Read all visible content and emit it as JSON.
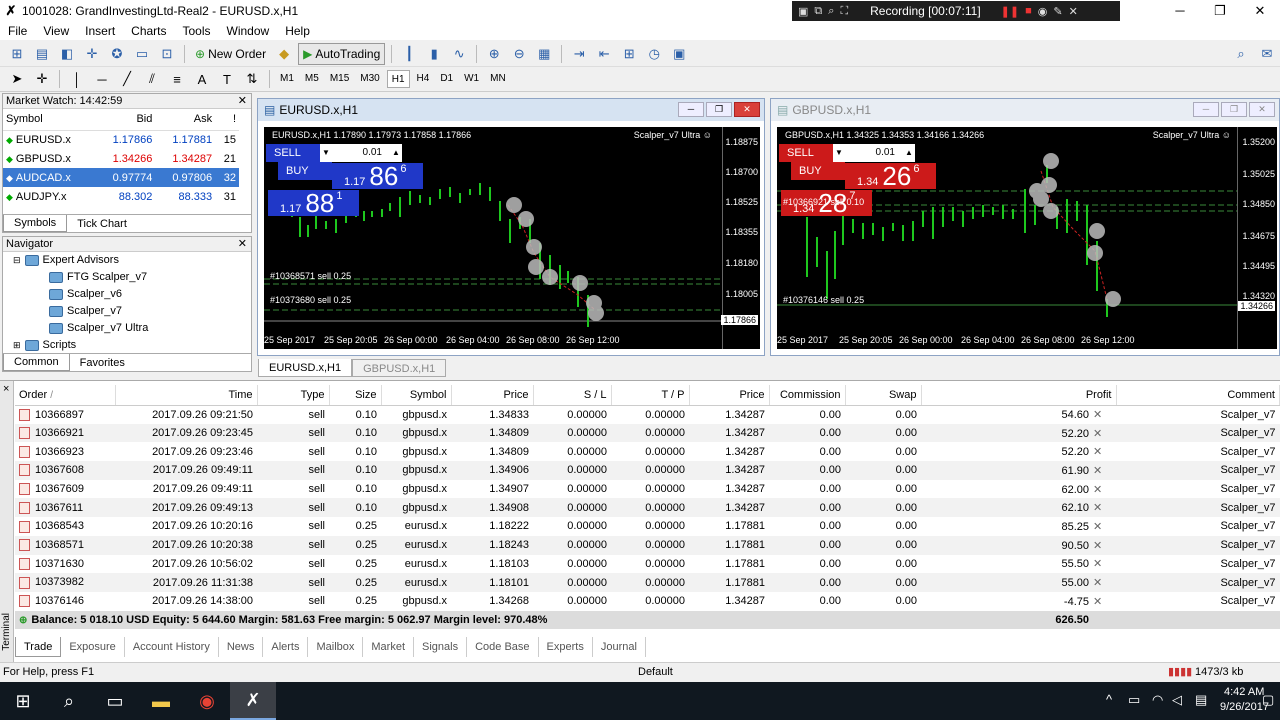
{
  "window": {
    "title": "1001028: GrandInvestingLtd-Real2 - EURUSD.x,H1",
    "logo": "✗"
  },
  "recorder": {
    "status": "Recording [00:07:11]"
  },
  "menu": [
    "File",
    "View",
    "Insert",
    "Charts",
    "Tools",
    "Window",
    "Help"
  ],
  "toolbar": {
    "new_order": "New Order",
    "autotrading": "AutoTrading"
  },
  "timeframes": [
    "M1",
    "M5",
    "M15",
    "M30",
    "H1",
    "H4",
    "D1",
    "W1",
    "MN"
  ],
  "market_watch": {
    "title": "Market Watch: 14:42:59",
    "headers": [
      "Symbol",
      "Bid",
      "Ask",
      "!"
    ],
    "rows": [
      {
        "symbol": "EURUSD.x",
        "bid": "1.17866",
        "ask": "1.17881",
        "spread": "15",
        "dir": "up"
      },
      {
        "symbol": "GBPUSD.x",
        "bid": "1.34266",
        "ask": "1.34287",
        "spread": "21",
        "dir": "up"
      },
      {
        "symbol": "AUDCAD.x",
        "bid": "0.97774",
        "ask": "0.97806",
        "spread": "32",
        "dir": "dn"
      },
      {
        "symbol": "AUDJPY.x",
        "bid": "88.302",
        "ask": "88.333",
        "spread": "31",
        "dir": "up"
      }
    ],
    "tabs": [
      "Symbols",
      "Tick Chart"
    ]
  },
  "navigator": {
    "title": "Navigator",
    "expert_advisors": "Expert Advisors",
    "items": [
      "FTG Scalper_v7",
      "Scalper_v6",
      "Scalper_v7",
      "Scalper_v7 Ultra"
    ],
    "scripts": "Scripts",
    "tabs": [
      "Common",
      "Favorites"
    ]
  },
  "chart_eur": {
    "window_title": "EURUSD.x,H1",
    "info": "EURUSD.x,H1  1.17890 1.17973 1.17858 1.17866",
    "ea": "Scalper_v7 Ultra ☺",
    "sell": "SELL",
    "buy": "BUY",
    "lot": "0.01",
    "sell_small": "1.17",
    "sell_big": "86",
    "sell_sup": "6",
    "buy_small": "1.17",
    "buy_big": "88",
    "buy_sup": "1",
    "yticks": [
      "1.18875",
      "1.18700",
      "1.18525",
      "1.18355",
      "1.18180",
      "1.18005",
      "1.17866"
    ],
    "xticks": [
      "25 Sep 2017",
      "25 Sep 20:05",
      "26 Sep 00:00",
      "26 Sep 04:00",
      "26 Sep 08:00",
      "26 Sep 12:00"
    ],
    "labels": [
      "#10368571 sell 0.25",
      "#10373680 sell 0.25"
    ]
  },
  "chart_gbp": {
    "window_title": "GBPUSD.x,H1",
    "info": "GBPUSD.x,H1  1.34325 1.34353 1.34166 1.34266",
    "ea": "Scalper_v7 Ultra ☺",
    "sell": "SELL",
    "buy": "BUY",
    "lot": "0.01",
    "sell_small": "1.34",
    "sell_big": "26",
    "sell_sup": "6",
    "buy_small": "1.34",
    "buy_big": "28",
    "buy_sup": "7",
    "yticks": [
      "1.35200",
      "1.35025",
      "1.34850",
      "1.34675",
      "1.34495",
      "1.34320",
      "1.34266"
    ],
    "xticks": [
      "25 Sep 2017",
      "25 Sep 20:05",
      "26 Sep 00:00",
      "26 Sep 04:00",
      "26 Sep 08:00",
      "26 Sep 12:00"
    ],
    "labels": [
      "#10366921 sell 0.10",
      "#10376146 sell 0.25"
    ]
  },
  "chart_tabs": [
    "EURUSD.x,H1",
    "GBPUSD.x,H1"
  ],
  "terminal": {
    "side_x": "×",
    "side_label": "Terminal",
    "headers": [
      "Order",
      "Time",
      "Type",
      "Size",
      "Symbol",
      "Price",
      "S / L",
      "T / P",
      "Price",
      "Commission",
      "Swap",
      "Profit",
      "Comment"
    ],
    "order_sort": "/",
    "rows": [
      [
        "10366897",
        "2017.09.26 09:21:50",
        "sell",
        "0.10",
        "gbpusd.x",
        "1.34833",
        "0.00000",
        "0.00000",
        "1.34287",
        "0.00",
        "0.00",
        "54.60",
        "Scalper_v7"
      ],
      [
        "10366921",
        "2017.09.26 09:23:45",
        "sell",
        "0.10",
        "gbpusd.x",
        "1.34809",
        "0.00000",
        "0.00000",
        "1.34287",
        "0.00",
        "0.00",
        "52.20",
        "Scalper_v7"
      ],
      [
        "10366923",
        "2017.09.26 09:23:46",
        "sell",
        "0.10",
        "gbpusd.x",
        "1.34809",
        "0.00000",
        "0.00000",
        "1.34287",
        "0.00",
        "0.00",
        "52.20",
        "Scalper_v7"
      ],
      [
        "10367608",
        "2017.09.26 09:49:11",
        "sell",
        "0.10",
        "gbpusd.x",
        "1.34906",
        "0.00000",
        "0.00000",
        "1.34287",
        "0.00",
        "0.00",
        "61.90",
        "Scalper_v7"
      ],
      [
        "10367609",
        "2017.09.26 09:49:11",
        "sell",
        "0.10",
        "gbpusd.x",
        "1.34907",
        "0.00000",
        "0.00000",
        "1.34287",
        "0.00",
        "0.00",
        "62.00",
        "Scalper_v7"
      ],
      [
        "10367611",
        "2017.09.26 09:49:13",
        "sell",
        "0.10",
        "gbpusd.x",
        "1.34908",
        "0.00000",
        "0.00000",
        "1.34287",
        "0.00",
        "0.00",
        "62.10",
        "Scalper_v7"
      ],
      [
        "10368543",
        "2017.09.26 10:20:16",
        "sell",
        "0.25",
        "eurusd.x",
        "1.18222",
        "0.00000",
        "0.00000",
        "1.17881",
        "0.00",
        "0.00",
        "85.25",
        "Scalper_v7"
      ],
      [
        "10368571",
        "2017.09.26 10:20:38",
        "sell",
        "0.25",
        "eurusd.x",
        "1.18243",
        "0.00000",
        "0.00000",
        "1.17881",
        "0.00",
        "0.00",
        "90.50",
        "Scalper_v7"
      ],
      [
        "10371630",
        "2017.09.26 10:56:02",
        "sell",
        "0.25",
        "eurusd.x",
        "1.18103",
        "0.00000",
        "0.00000",
        "1.17881",
        "0.00",
        "0.00",
        "55.50",
        "Scalper_v7"
      ],
      [
        "10373982",
        "2017.09.26 11:31:38",
        "sell",
        "0.25",
        "eurusd.x",
        "1.18101",
        "0.00000",
        "0.00000",
        "1.17881",
        "0.00",
        "0.00",
        "55.00",
        "Scalper_v7"
      ],
      [
        "10376146",
        "2017.09.26 14:38:00",
        "sell",
        "0.25",
        "gbpusd.x",
        "1.34268",
        "0.00000",
        "0.00000",
        "1.34287",
        "0.00",
        "0.00",
        "-4.75",
        "Scalper_v7"
      ]
    ],
    "balance_line": "Balance: 5 018.10 USD  Equity: 5 644.60  Margin: 581.63  Free margin: 5 062.97  Margin level: 970.48%",
    "total_profit": "626.50",
    "tabs": [
      "Trade",
      "Exposure",
      "Account History",
      "News",
      "Alerts",
      "Mailbox",
      "Market",
      "Signals",
      "Code Base",
      "Experts",
      "Journal"
    ]
  },
  "status": {
    "help": "For Help, press F1",
    "profile": "Default",
    "traffic": "1473/3 kb"
  },
  "taskbar": {
    "time": "4:42 AM",
    "date": "9/26/2017"
  }
}
